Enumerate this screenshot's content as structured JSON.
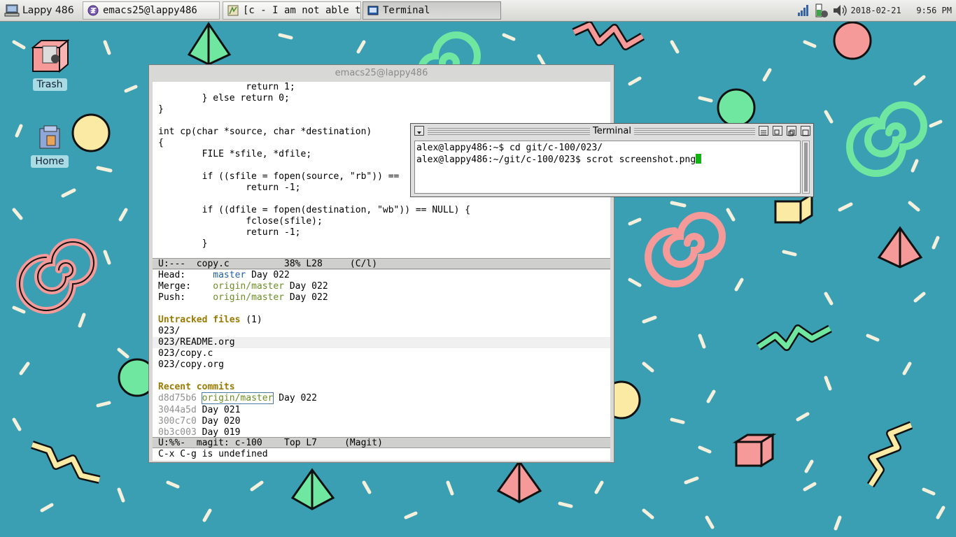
{
  "taskbar": {
    "start_label": "Lappy 486",
    "tasks": [
      {
        "label": "emacs25@lappy486"
      },
      {
        "label": "[c - I am not able t…"
      },
      {
        "label": "Terminal"
      }
    ],
    "clock": {
      "date": "2018-02-21",
      "time": "9:56 PM"
    },
    "tray_icons": [
      "network-icon",
      "battery-icon",
      "volume-icon"
    ]
  },
  "desktop": {
    "icons": [
      {
        "label": "Trash",
        "icon": "trash-icon"
      },
      {
        "label": "Home",
        "icon": "home-folder-icon"
      }
    ]
  },
  "emacs": {
    "title": "emacs25@lappy486",
    "code_lines": [
      "                return 1;",
      "        } else return 0;",
      "}",
      "",
      "int cp(char *source, char *destination)",
      "{",
      "        FILE *sfile, *dfile;",
      "",
      "        if ((sfile = fopen(source, \"rb\")) ==",
      "                return -1;",
      "",
      "        if ((dfile = fopen(destination, \"wb\")) == NULL) {",
      "                fclose(sfile);",
      "                return -1;",
      "        }"
    ],
    "code_modeline": "U:---  copy.c          38% L28     (C/l)",
    "magit": {
      "head_label": "Head:",
      "head_branch": "master",
      "head_msg": "Day 022",
      "merge_label": "Merge:",
      "merge_branch": "origin/master",
      "merge_msg": "Day 022",
      "push_label": "Push:",
      "push_branch": "origin/master",
      "push_msg": "Day 022",
      "untracked_header": "Untracked files",
      "untracked_count": "(1)",
      "untracked_files": [
        "023/",
        "023/README.org",
        "023/copy.c",
        "023/copy.org"
      ],
      "recent_header": "Recent commits",
      "commits": [
        {
          "hash": "d8d75b6",
          "ref": "origin/master",
          "msg": "Day 022"
        },
        {
          "hash": "3044a5d",
          "ref": "",
          "msg": "Day 021"
        },
        {
          "hash": "300c7c0",
          "ref": "",
          "msg": "Day 020"
        },
        {
          "hash": "0b3c003",
          "ref": "",
          "msg": "Day 019"
        }
      ]
    },
    "magit_modeline": "U:%%-  magit: c-100    Top L7     (Magit)",
    "minibuffer": "C-x C-g is undefined"
  },
  "terminal": {
    "title": "Terminal",
    "lines": [
      "alex@lappy486:~$ cd git/c-100/023/",
      "alex@lappy486:~/git/c-100/023$ scrot screenshot.png"
    ]
  }
}
